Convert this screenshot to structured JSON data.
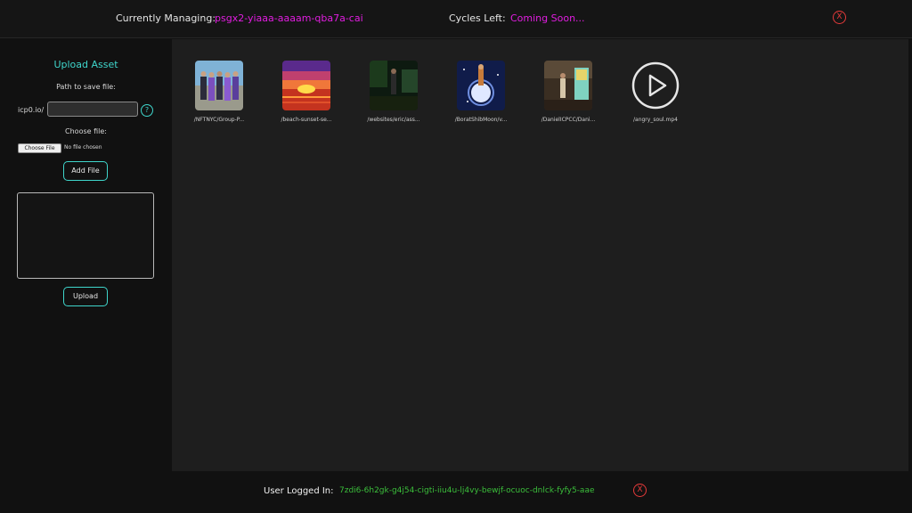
{
  "header": {
    "managing_label": "Currently Managing:",
    "canister_id": "psgx2-yiaaa-aaaam-qba7a-cai",
    "cycles_label": "Cycles Left:",
    "cycles_value": "Coming Soon...",
    "close_symbol": "X"
  },
  "sidebar": {
    "title": "Upload Asset",
    "path_label": "Path to save file:",
    "path_prefix": "icp0.io/",
    "path_value": "",
    "help_symbol": "?",
    "choose_label": "Choose file:",
    "choose_button": "Choose File",
    "no_file_text": "No file chosen",
    "add_file_button": "Add File",
    "upload_button": "Upload"
  },
  "assets": [
    {
      "label": "/NFTNYC/Group-P...",
      "icon": "group-photo-thumbnail"
    },
    {
      "label": "/beach-sunset-se...",
      "icon": "beach-sunset-thumbnail"
    },
    {
      "label": "/websites/eric/ass...",
      "icon": "night-scene-thumbnail"
    },
    {
      "label": "/BoratShibMoon/v...",
      "icon": "moon-art-thumbnail"
    },
    {
      "label": "/DanielICPCC/Dani...",
      "icon": "room-photo-thumbnail"
    },
    {
      "label": "/angry_soul.mp4",
      "icon": "play-icon"
    }
  ],
  "footer": {
    "user_label": "User Logged In:",
    "principal": "7zdi6-6h2gk-g4j54-cigti-iiu4u-lj4vy-bewjf-ocuoc-dnlck-fyfy5-aae",
    "close_symbol": "X"
  },
  "colors": {
    "accent_teal": "#3fd6cc",
    "magenta": "#e11de0",
    "green": "#3bbf3b",
    "close_red": "#e63a3a"
  }
}
